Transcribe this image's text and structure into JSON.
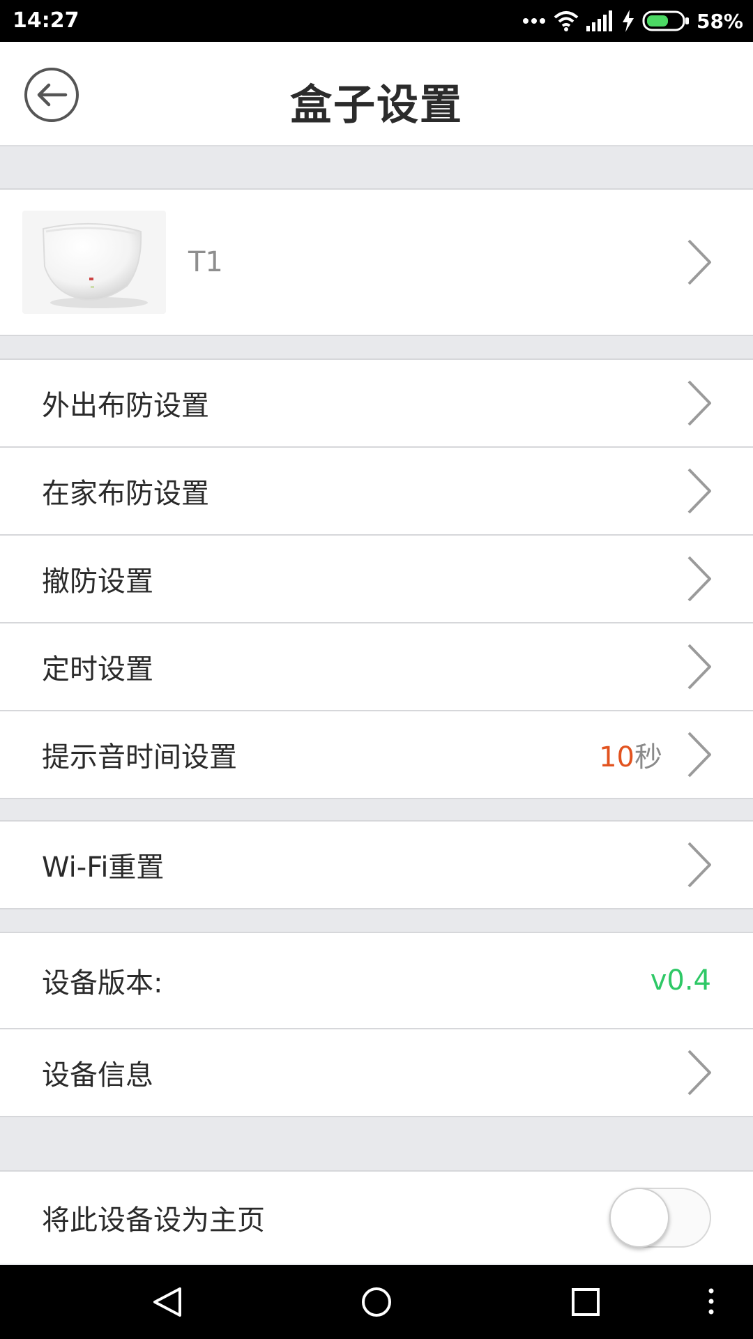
{
  "status_bar": {
    "time": "14:27",
    "battery_percent": "58%",
    "battery_color": "#4cd964",
    "icons": [
      "more-dots-icon",
      "wifi-icon",
      "signal-icon",
      "charging-icon",
      "battery-icon"
    ]
  },
  "header": {
    "title": "盒子设置",
    "back_icon": "back-arrow-icon"
  },
  "device": {
    "name": "T1",
    "image": "device-photo"
  },
  "menu": {
    "away_arm": "外出布防设置",
    "home_arm": "在家布防设置",
    "disarm": "撤防设置",
    "timer": "定时设置",
    "tone_time": "提示音时间设置",
    "tone_time_value": "10",
    "tone_time_unit": "秒",
    "wifi_reset": "Wi-Fi重置",
    "device_version": "设备版本:",
    "device_version_value": "v0.4",
    "device_info": "设备信息",
    "set_home": "将此设备设为主页"
  },
  "toggle": {
    "set_home_enabled": false
  },
  "colors": {
    "accent_orange": "#e2531f",
    "version_green": "#2ec866",
    "background": "#e8e9ec"
  },
  "nav_bar": {
    "icons": [
      "nav-back-icon",
      "nav-home-icon",
      "nav-recents-icon",
      "nav-menu-icon"
    ]
  }
}
